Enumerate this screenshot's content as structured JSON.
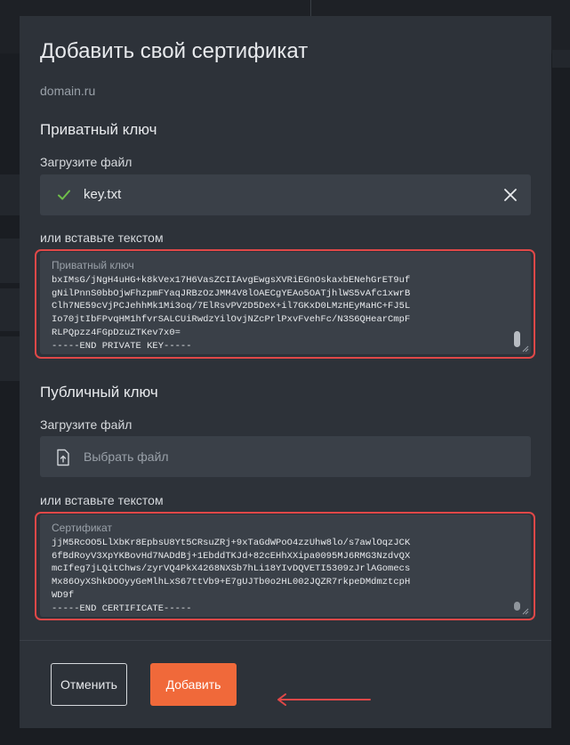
{
  "modal": {
    "title": "Добавить свой сертификат",
    "domain": "domain.ru"
  },
  "private_key": {
    "section_title": "Приватный ключ",
    "upload_label": "Загрузите файл",
    "uploaded_file": "key.txt",
    "paste_label": "или вставьте текстом",
    "textarea_placeholder": "Приватный ключ",
    "textarea_value": "bxIMsG/jNgH4uHG+k8kVex17H6VasZCIIAvgEwgsXVRiEGnOskaxbENehGrET9uf\ngNilPnnS0bbOjwFhzpmFYaqJRBzOzJMM4V8lOAECgYEAo5OATjhlWS5vAfc1xwrB\nClh7NE59cVjPCJehhMk1Mi3oq/7ElRsvPV2D5DeX+il7GKxD0LMzHEyMaHC+FJ5L\nIo70jtIbFPvqHM1hfvrSALCUiRwdzYilOvjNZcPrlPxvFvehFc/N3S6QHearCmpF\nRLPQpzz4FGpDzuZTKev7x0=\n-----END PRIVATE KEY-----"
  },
  "public_key": {
    "section_title": "Публичный ключ",
    "upload_label": "Загрузите файл",
    "choose_file": "Выбрать файл",
    "paste_label": "или вставьте текстом",
    "textarea_placeholder": "Сертификат",
    "textarea_value": "jjM5RcOO5LlXbKr8EpbsU8Yt5CRsuZRj+9xTaGdWPoO4zzUhw8lo/s7awlOqzJCK\n6fBdRoyV3XpYKBovHd7NADdBj+1EbddTKJd+82cEHhXXipa0095MJ6RMG3NzdvQX\nmcIfeg7jLQitChws/zyrVQ4PkX4268NXSb7hLi18YIvDQVETI5309zJrlAGomecs\nMx86OyXShkDOOyyGeMlhLxS67ttVb9+E7gUJTb0o2HL002JQZR7rkpeDMdmztcpH\nWD9f\n-----END CERTIFICATE-----"
  },
  "footer": {
    "cancel_label": "Отменить",
    "add_label": "Добавить"
  },
  "colors": {
    "accent": "#f0693a",
    "highlight": "#e04848",
    "success": "#6fbf4a"
  },
  "icons": [
    "check-icon",
    "close-icon",
    "upload-file-icon",
    "arrow-left-icon"
  ]
}
